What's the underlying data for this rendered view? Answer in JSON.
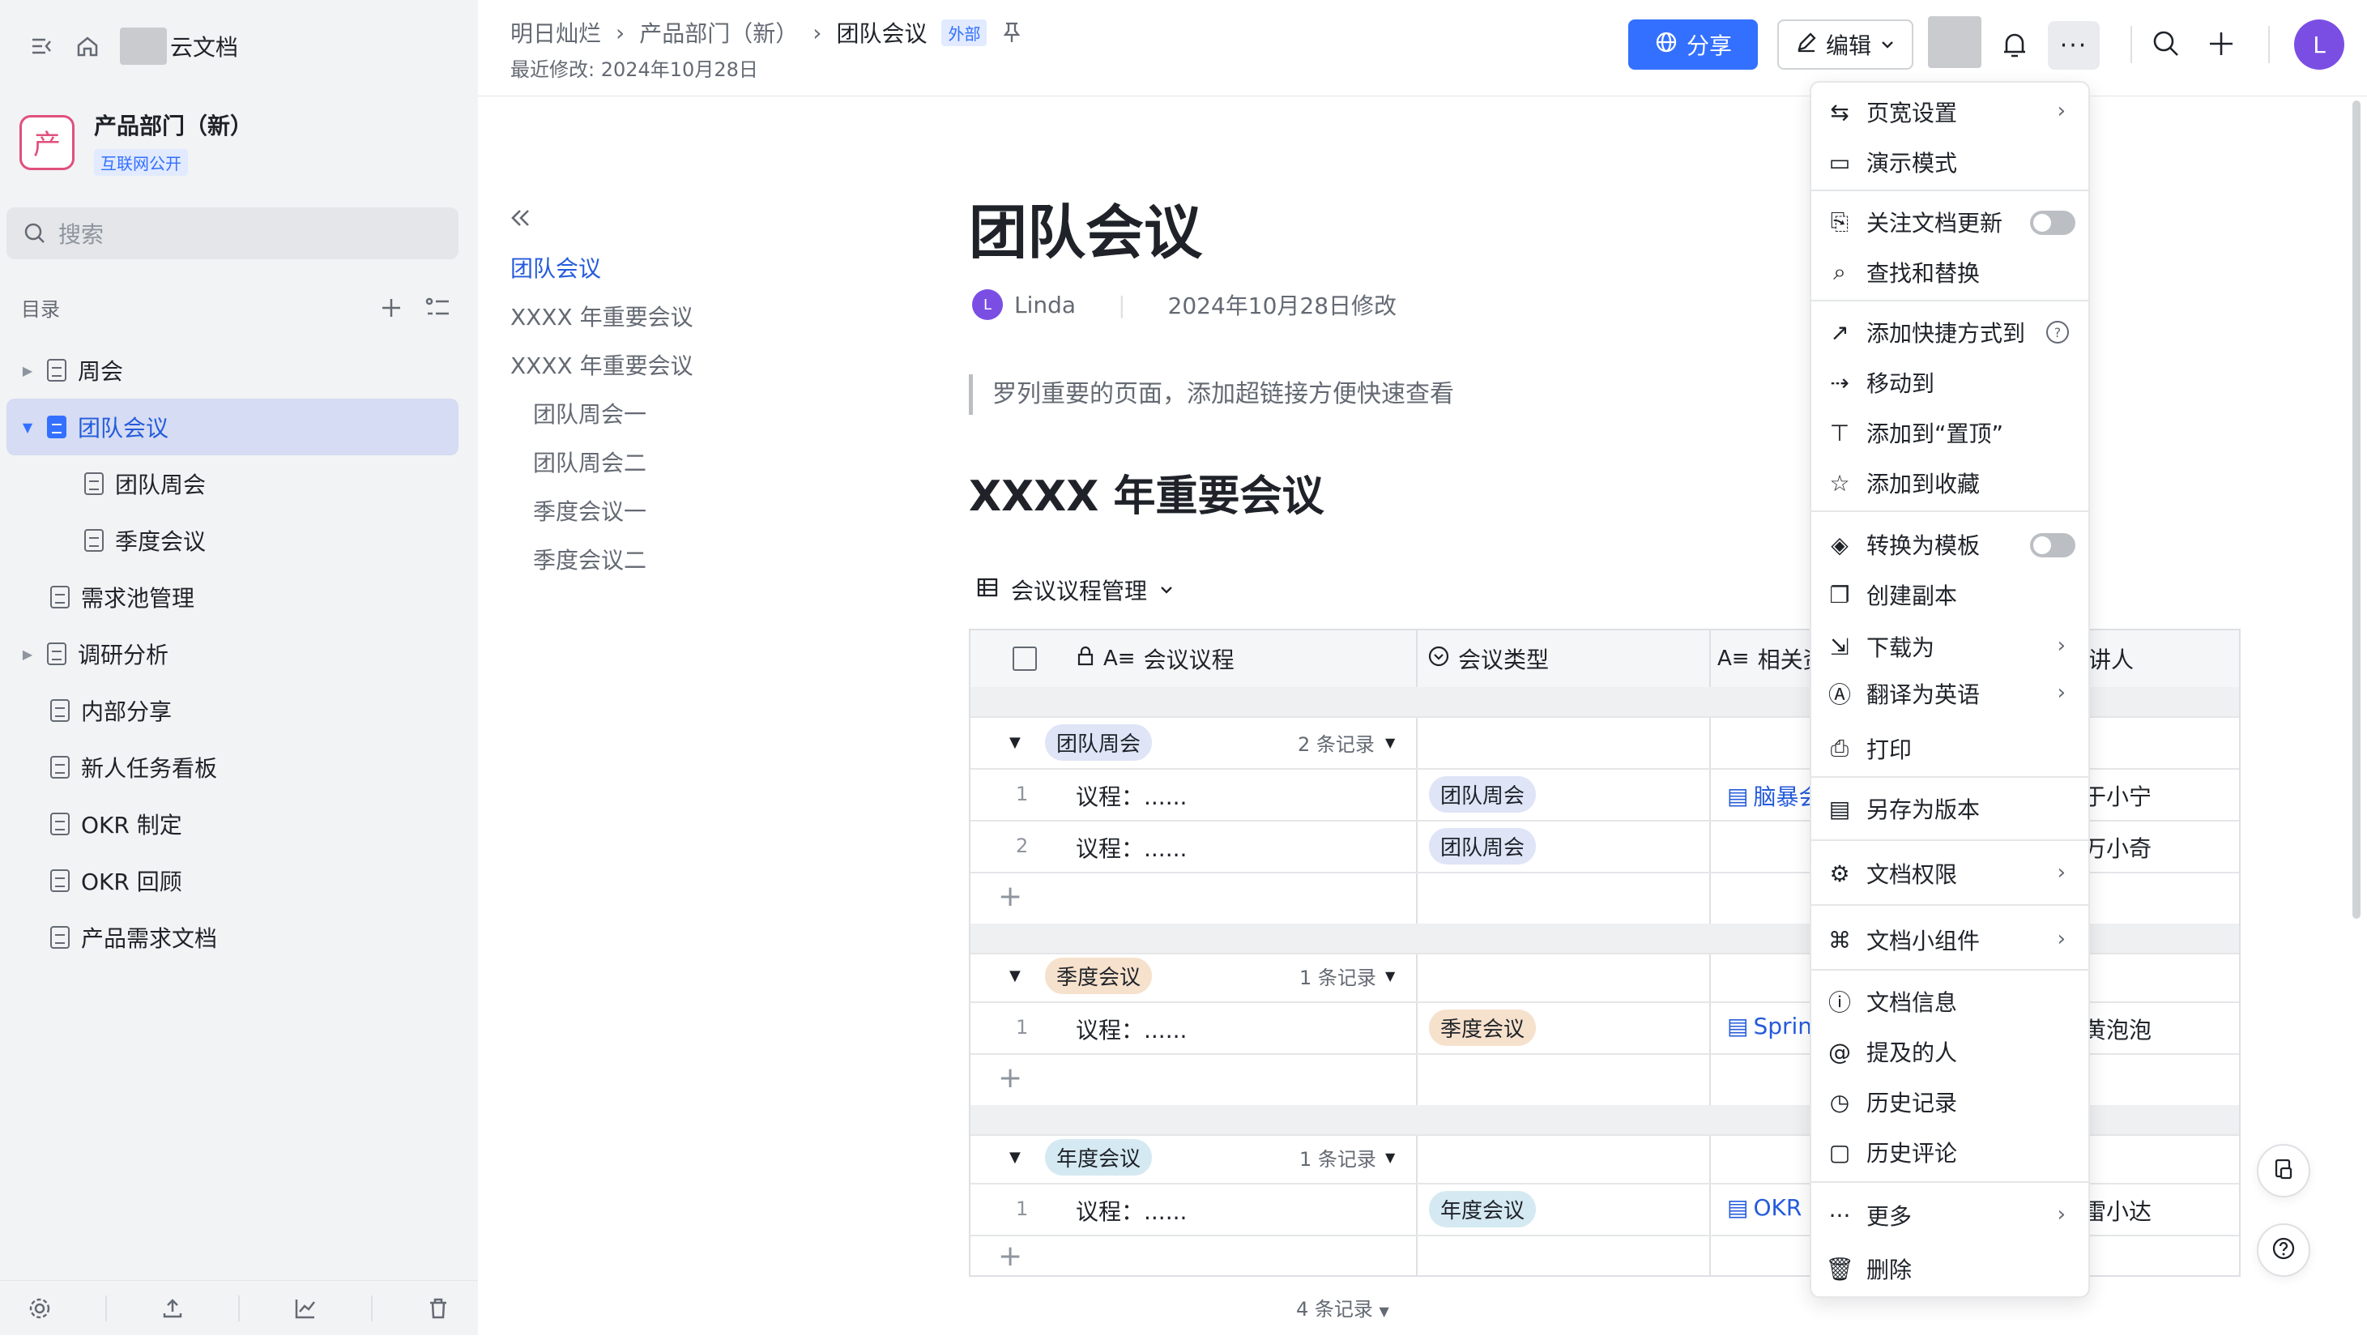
{
  "workspace": {
    "name": "云文档"
  },
  "space": {
    "title": "产品部门（新）",
    "badge": "互联网公开",
    "logo_char": "产"
  },
  "search": {
    "placeholder": "搜索"
  },
  "toc": {
    "label": "目录"
  },
  "tree": [
    {
      "label": "周会",
      "expandable": true
    },
    {
      "label": "团队会议",
      "expanded": true,
      "active": true
    },
    {
      "label": "团队周会",
      "child": true
    },
    {
      "label": "季度会议",
      "child": true
    },
    {
      "label": "需求池管理"
    },
    {
      "label": "调研分析",
      "expandable": true
    },
    {
      "label": "内部分享"
    },
    {
      "label": "新人任务看板"
    },
    {
      "label": "OKR 制定"
    },
    {
      "label": "OKR 回顾"
    },
    {
      "label": "产品需求文档"
    }
  ],
  "breadcrumb": {
    "items": [
      "明日灿烂",
      "产品部门（新）",
      "团队会议"
    ],
    "badge": "外部",
    "last_modified": "最近修改: 2024年10月28日"
  },
  "toolbar": {
    "share_label": "分享",
    "edit_label": "编辑",
    "avatar_initial": "L"
  },
  "outline": {
    "items": [
      "团队会议",
      "XXXX 年重要会议",
      "XXXX 年重要会议"
    ],
    "sub_items": [
      "团队周会一",
      "团队周会二",
      "季度会议一",
      "季度会议二"
    ]
  },
  "doc": {
    "title": "团队会议",
    "author": "Linda",
    "author_initial": "L",
    "modified": "2024年10月28日修改",
    "quote": "罗列重要的页面，添加超链接方便快速查看",
    "heading": "XXXX 年重要会议"
  },
  "table": {
    "view_name": "会议议程管理",
    "columns": [
      "会议议程",
      "会议类型",
      "相关资",
      "讲人"
    ],
    "groups": [
      {
        "name": "团队周会",
        "count": "2 条记录",
        "color": "#dfe4f7",
        "rows": [
          {
            "num": "1",
            "agenda": "议程：......",
            "type": "团队周会",
            "link": "脑暴会",
            "person": "于小宁"
          },
          {
            "num": "2",
            "agenda": "议程：......",
            "type": "团队周会",
            "link": "",
            "person": "万小奇"
          }
        ]
      },
      {
        "name": "季度会议",
        "count": "1 条记录",
        "color": "#f6e1cc",
        "rows": [
          {
            "num": "1",
            "agenda": "议程：......",
            "type": "季度会议",
            "link": "Sprin",
            "person": "黄泡泡"
          }
        ]
      },
      {
        "name": "年度会议",
        "count": "1 条记录",
        "color": "#d5e9f2",
        "rows": [
          {
            "num": "1",
            "agenda": "议程：......",
            "type": "年度会议",
            "link": "OKR",
            "person": "雷小达"
          }
        ]
      }
    ],
    "total": "4 条记录"
  },
  "menu": [
    {
      "label": "页宽设置",
      "icon": "page-width-icon",
      "chevron": true
    },
    {
      "label": "演示模式",
      "icon": "presentation-icon"
    },
    {
      "label": "关注文档更新",
      "icon": "follow-icon",
      "toggle": true
    },
    {
      "label": "查找和替换",
      "icon": "find-replace-icon"
    },
    {
      "label": "添加快捷方式到",
      "icon": "shortcut-icon",
      "help": true
    },
    {
      "label": "移动到",
      "icon": "move-icon"
    },
    {
      "label": "添加到“置顶”",
      "icon": "pin-icon"
    },
    {
      "label": "添加到收藏",
      "icon": "star-icon"
    },
    {
      "label": "转换为模板",
      "icon": "template-icon",
      "toggle": true
    },
    {
      "label": "创建副本",
      "icon": "copy-icon"
    },
    {
      "label": "下载为",
      "icon": "download-icon",
      "chevron": true
    },
    {
      "label": "翻译为英语",
      "icon": "translate-icon",
      "chevron": true
    },
    {
      "label": "打印",
      "icon": "print-icon"
    },
    {
      "label": "另存为版本",
      "icon": "version-icon"
    },
    {
      "label": "文档权限",
      "icon": "permission-icon",
      "chevron": true
    },
    {
      "label": "文档小组件",
      "icon": "widget-icon",
      "chevron": true
    },
    {
      "label": "文档信息",
      "icon": "info-icon"
    },
    {
      "label": "提及的人",
      "icon": "mention-icon"
    },
    {
      "label": "历史记录",
      "icon": "history-icon"
    },
    {
      "label": "历史评论",
      "icon": "comment-history-icon"
    },
    {
      "label": "更多",
      "icon": "more-icon",
      "chevron": true
    },
    {
      "label": "删除",
      "icon": "delete-icon"
    }
  ]
}
